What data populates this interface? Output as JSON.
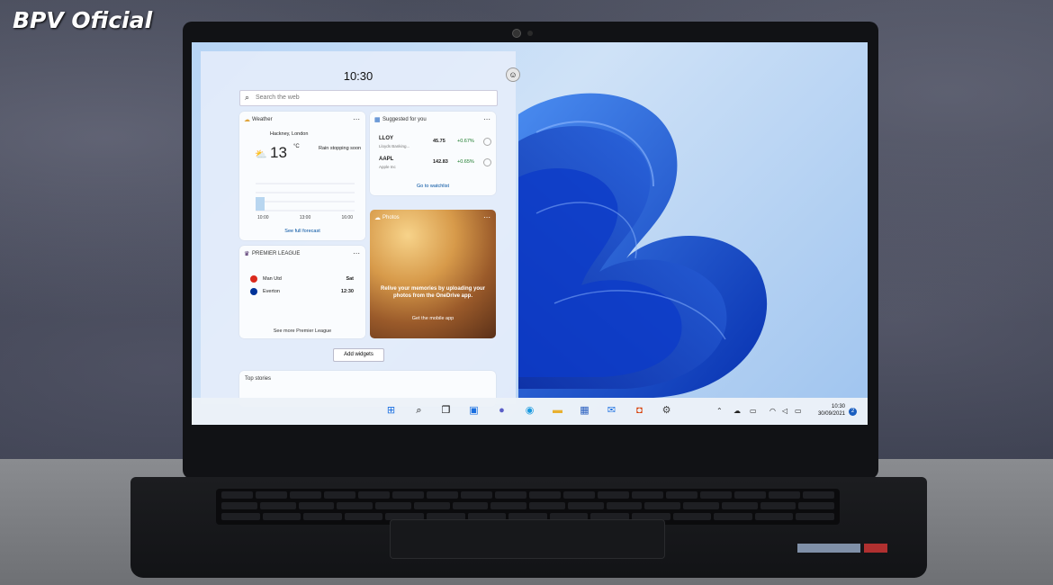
{
  "watermark": "BPV Oficial",
  "widgets": {
    "clock": "10:30",
    "search_placeholder": "Search the web",
    "weather": {
      "title": "Weather",
      "location": "Hackney, London",
      "temp": "13",
      "unit": "°C",
      "condition": "Rain stopping soon",
      "times": [
        "10:00",
        "13:00",
        "16:00"
      ],
      "link": "See full forecast"
    },
    "suggested": {
      "title": "Suggested for you",
      "stocks": [
        {
          "symbol": "LLOY",
          "name": "Lloyds Banking...",
          "price": "45.75",
          "change": "+0.67%"
        },
        {
          "symbol": "AAPL",
          "name": "Apple Inc",
          "price": "142.83",
          "change": "+0.65%"
        }
      ],
      "link": "Go to watchlist"
    },
    "photos": {
      "title": "Photos",
      "message": "Relive your memories by uploading your photos from the OneDrive app.",
      "button": "Get the mobile app"
    },
    "league": {
      "title": "PREMIER LEAGUE",
      "rows": [
        {
          "team": "Man Utd",
          "value": "Sat"
        },
        {
          "team": "Everton",
          "value": "12:30"
        }
      ],
      "link": "See more Premier League"
    },
    "add_widgets": "Add widgets",
    "top_stories": "Top stories"
  },
  "taskbar": {
    "time": "10:30",
    "date": "30/09/2021",
    "notification_count": "2",
    "apps": [
      "start-icon",
      "search-icon",
      "task-view-icon",
      "widgets-icon",
      "chat-icon",
      "edge-icon",
      "file-explorer-icon",
      "store-icon",
      "mail-icon",
      "office-icon",
      "settings-icon"
    ]
  },
  "colors": {
    "accent": "#1a5fc0",
    "bloom": "#0a3fd0"
  }
}
